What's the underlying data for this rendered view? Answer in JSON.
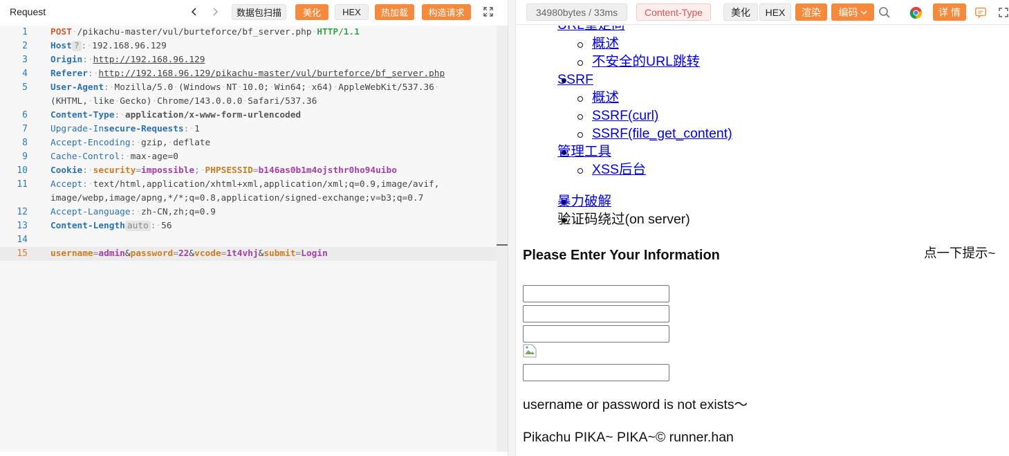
{
  "request": {
    "title": "Request",
    "toolbar": {
      "scan_label": "数据包扫描",
      "beautify_label": "美化",
      "hex_label": "HEX",
      "hot_load_label": "热加载",
      "build_request_label": "构造请求"
    },
    "lines": [
      {
        "num": "1",
        "parts": [
          {
            "t": "POST",
            "c": "k-method"
          },
          {
            "t": "·",
            "c": "sp"
          },
          {
            "t": "/pikachu-master/vul/burteforce/bf_server.php",
            "c": "k-val"
          },
          {
            "t": "·",
            "c": "sp"
          },
          {
            "t": "HTTP/1.1",
            "c": "k-http"
          }
        ]
      },
      {
        "num": "2",
        "parts": [
          {
            "t": "Host",
            "c": "k-hdrb"
          },
          {
            "t": "?",
            "c": "k-badge"
          },
          {
            "t": ":",
            "c": "k-sep"
          },
          {
            "t": "·",
            "c": "sp"
          },
          {
            "t": "192.168.96.129",
            "c": "k-val"
          }
        ]
      },
      {
        "num": "3",
        "parts": [
          {
            "t": "Origin",
            "c": "k-hdrb"
          },
          {
            "t": ":",
            "c": "k-sep"
          },
          {
            "t": "·",
            "c": "sp"
          },
          {
            "t": "http://192.168.96.129",
            "c": "k-link"
          }
        ]
      },
      {
        "num": "4",
        "parts": [
          {
            "t": "Referer",
            "c": "k-hdrb"
          },
          {
            "t": ":",
            "c": "k-sep"
          },
          {
            "t": "·",
            "c": "sp"
          },
          {
            "t": "http://192.168.96.129/pikachu-master/vul/burteforce/bf_server.php",
            "c": "k-link"
          }
        ]
      },
      {
        "num": "5",
        "parts": [
          {
            "t": "User-Agent",
            "c": "k-hdrb"
          },
          {
            "t": ":",
            "c": "k-sep"
          },
          {
            "t": "·",
            "c": "sp"
          },
          {
            "t": "Mozilla/5.0",
            "c": "k-val"
          },
          {
            "t": "·",
            "c": "sp"
          },
          {
            "t": "(Windows",
            "c": "k-val"
          },
          {
            "t": "·",
            "c": "sp"
          },
          {
            "t": "NT",
            "c": "k-val"
          },
          {
            "t": "·",
            "c": "sp"
          },
          {
            "t": "10.0;",
            "c": "k-val"
          },
          {
            "t": "·",
            "c": "sp"
          },
          {
            "t": "Win64;",
            "c": "k-val"
          },
          {
            "t": "·",
            "c": "sp"
          },
          {
            "t": "x64)",
            "c": "k-val"
          },
          {
            "t": "·",
            "c": "sp"
          },
          {
            "t": "AppleWebKit/537.36",
            "c": "k-val"
          },
          {
            "t": "·",
            "c": "sp"
          }
        ]
      },
      {
        "num": "",
        "parts": [
          {
            "t": "(KHTML,",
            "c": "k-val"
          },
          {
            "t": "·",
            "c": "sp"
          },
          {
            "t": "like",
            "c": "k-val"
          },
          {
            "t": "·",
            "c": "sp"
          },
          {
            "t": "Gecko)",
            "c": "k-val"
          },
          {
            "t": "·",
            "c": "sp"
          },
          {
            "t": "Chrome/143.0.0.0",
            "c": "k-val"
          },
          {
            "t": "·",
            "c": "sp"
          },
          {
            "t": "Safari/537.36",
            "c": "k-val"
          }
        ]
      },
      {
        "num": "6",
        "parts": [
          {
            "t": "Content-Type",
            "c": "k-hdrb"
          },
          {
            "t": ":",
            "c": "k-sep"
          },
          {
            "t": "·",
            "c": "sp"
          },
          {
            "t": "application/x-www-form-urlencoded",
            "c": "k-valb"
          }
        ]
      },
      {
        "num": "7",
        "parts": [
          {
            "t": "Upgrade-In",
            "c": "k-hdr"
          },
          {
            "t": "secure-Requests",
            "c": "k-hdrb"
          },
          {
            "t": ":",
            "c": "k-sep"
          },
          {
            "t": "·",
            "c": "sp"
          },
          {
            "t": "1",
            "c": "k-val"
          }
        ]
      },
      {
        "num": "8",
        "parts": [
          {
            "t": "Accept-Encoding",
            "c": "k-hdr"
          },
          {
            "t": ":",
            "c": "k-sep"
          },
          {
            "t": "·",
            "c": "sp"
          },
          {
            "t": "gzip,",
            "c": "k-val"
          },
          {
            "t": "·",
            "c": "sp"
          },
          {
            "t": "deflate",
            "c": "k-val"
          }
        ]
      },
      {
        "num": "9",
        "parts": [
          {
            "t": "Cache-Control",
            "c": "k-hdr"
          },
          {
            "t": ":",
            "c": "k-sep"
          },
          {
            "t": "·",
            "c": "sp"
          },
          {
            "t": "max-age=0",
            "c": "k-val"
          }
        ]
      },
      {
        "num": "10",
        "parts": [
          {
            "t": "Cookie",
            "c": "k-hdrb"
          },
          {
            "t": ":",
            "c": "k-sep"
          },
          {
            "t": "·",
            "c": "sp"
          },
          {
            "t": "security",
            "c": "k-ckey"
          },
          {
            "t": "=",
            "c": "k-sep"
          },
          {
            "t": "impossible",
            "c": "k-cval"
          },
          {
            "t": ";",
            "c": "k-sep"
          },
          {
            "t": "·",
            "c": "sp"
          },
          {
            "t": "PHPSESSID",
            "c": "k-ckey"
          },
          {
            "t": "=",
            "c": "k-sep"
          },
          {
            "t": "b146as0b1m4ojsthr0ho94uibo",
            "c": "k-cval"
          }
        ]
      },
      {
        "num": "11",
        "parts": [
          {
            "t": "Accept",
            "c": "k-hdr"
          },
          {
            "t": ":",
            "c": "k-sep"
          },
          {
            "t": "·",
            "c": "sp"
          },
          {
            "t": "text/html,application/xhtml+xml,application/xml;q=0.9,image/avif,",
            "c": "k-val"
          }
        ]
      },
      {
        "num": "",
        "parts": [
          {
            "t": "image/webp,image/apng,*/*;q=0.8,application/signed-exchange;v=b3;q=0.7",
            "c": "k-val"
          }
        ]
      },
      {
        "num": "12",
        "parts": [
          {
            "t": "Accept-Language",
            "c": "k-hdr"
          },
          {
            "t": ":",
            "c": "k-sep"
          },
          {
            "t": "·",
            "c": "sp"
          },
          {
            "t": "zh-CN,zh;q=0.9",
            "c": "k-val"
          }
        ]
      },
      {
        "num": "13",
        "parts": [
          {
            "t": "Content-Length",
            "c": "k-hdrb"
          },
          {
            "t": "auto",
            "c": "k-badge"
          },
          {
            "t": ":",
            "c": "k-sep"
          },
          {
            "t": "·",
            "c": "sp"
          },
          {
            "t": "56",
            "c": "k-val"
          }
        ]
      },
      {
        "num": "14",
        "parts": []
      },
      {
        "num": "15",
        "active": true,
        "parts": [
          {
            "t": "username",
            "c": "k-ckey"
          },
          {
            "t": "=",
            "c": "k-sep"
          },
          {
            "t": "admin",
            "c": "k-cval"
          },
          {
            "t": "&",
            "c": "k-val"
          },
          {
            "t": "password",
            "c": "k-ckey"
          },
          {
            "t": "=",
            "c": "k-sep"
          },
          {
            "t": "22",
            "c": "k-cval"
          },
          {
            "t": "&",
            "c": "k-val"
          },
          {
            "t": "vcode",
            "c": "k-ckey"
          },
          {
            "t": "=",
            "c": "k-sep"
          },
          {
            "t": "1t4vhj",
            "c": "k-cval"
          },
          {
            "t": "&",
            "c": "k-val"
          },
          {
            "t": "submit",
            "c": "k-ckey"
          },
          {
            "t": "=",
            "c": "k-sep"
          },
          {
            "t": "Login",
            "c": "k-cval"
          }
        ]
      }
    ]
  },
  "response": {
    "toolbar": {
      "stats": "34980bytes / 33ms",
      "content_type": "Content-Type",
      "beautify_label": "美化",
      "hex_label": "HEX",
      "render_label": "渲染",
      "encoding_label": "编码",
      "details_label": "详 情"
    },
    "render": {
      "top_cut_link": "URL重定向",
      "url_redirect_children": [
        "概述",
        "不安全的URL跳转"
      ],
      "ssrf_label": "SSRF",
      "ssrf_children": [
        "概述",
        "SSRF(curl)",
        "SSRF(file_get_content)"
      ],
      "admin_tools_label": "管理工具",
      "admin_tools_children": [
        "XSS后台"
      ],
      "brute_force_label": "暴力破解",
      "captcha_bypass_label": "验证码绕过(on server)",
      "form_title": "Please Enter Your Information",
      "hint_link": "点一下提示~",
      "result_message": "username or password is not exists～",
      "footer": "Pikachu PIKA~ PIKA~© runner.han"
    }
  },
  "colors": {
    "accent_orange": "#f5893c",
    "link_blue": "#0000ee",
    "line_number_blue": "#2a7bbf",
    "active_line_number": "#e07b24"
  }
}
